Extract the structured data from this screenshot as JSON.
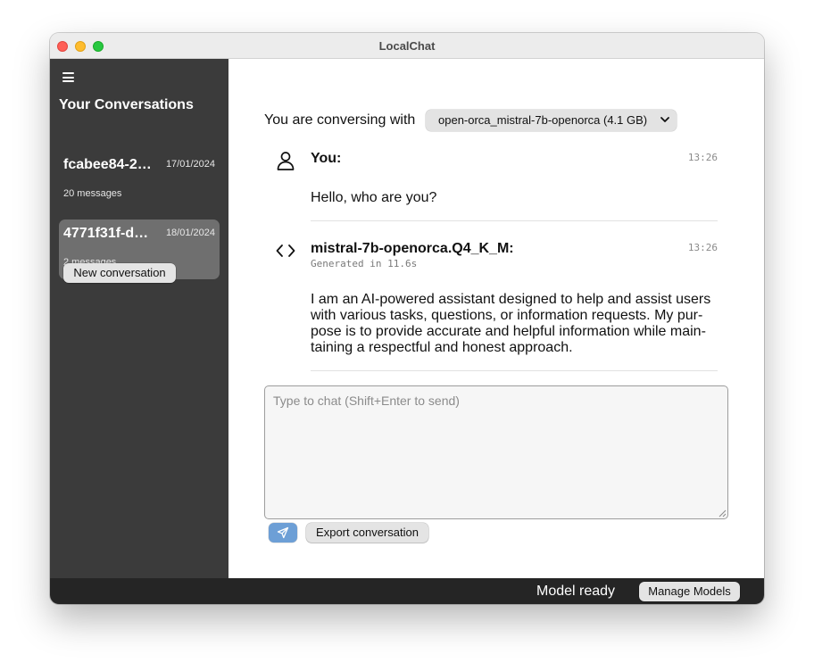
{
  "window": {
    "title": "LocalChat"
  },
  "sidebar": {
    "heading": "Your Conversations",
    "conversations": [
      {
        "title": "fcabee84-2…",
        "date": "17/01/2024",
        "count": "20 messages",
        "selected": false
      },
      {
        "title": "4771f31f-d…",
        "date": "18/01/2024",
        "count": "2 messages",
        "selected": true
      }
    ],
    "new_conversation_label": "New conversation"
  },
  "main": {
    "conversing_label": "You are conversing with",
    "model_select": {
      "selected": "open-orca_mistral-7b-openorca (4.1 GB)"
    },
    "messages": [
      {
        "author": "You:",
        "time": "13:26",
        "icon": "user-icon",
        "body": "Hello, who are you?"
      },
      {
        "author": "mistral-7b-openorca.Q4_K_M:",
        "time": "13:26",
        "icon": "code-brackets-icon",
        "subtitle": "Generated in 11.6s",
        "body_lines": [
          "I am an AI-powered assistant designed to help and assist users",
          "with various tasks, questions, or information requests. My pur-",
          "pose is to provide accurate and helpful information while main-",
          "taining a respectful and honest approach."
        ]
      }
    ],
    "chat_input": {
      "placeholder": "Type to chat (Shift+Enter to send)",
      "value": ""
    },
    "export_label": "Export conversation"
  },
  "footer": {
    "status": "Model ready",
    "manage_models_label": "Manage Models"
  },
  "colors": {
    "sidebar_bg": "#3b3b3b",
    "selected_item_bg": "#6f6f6f",
    "footer_bg": "#252525",
    "send_button": "#6d9fd6"
  }
}
